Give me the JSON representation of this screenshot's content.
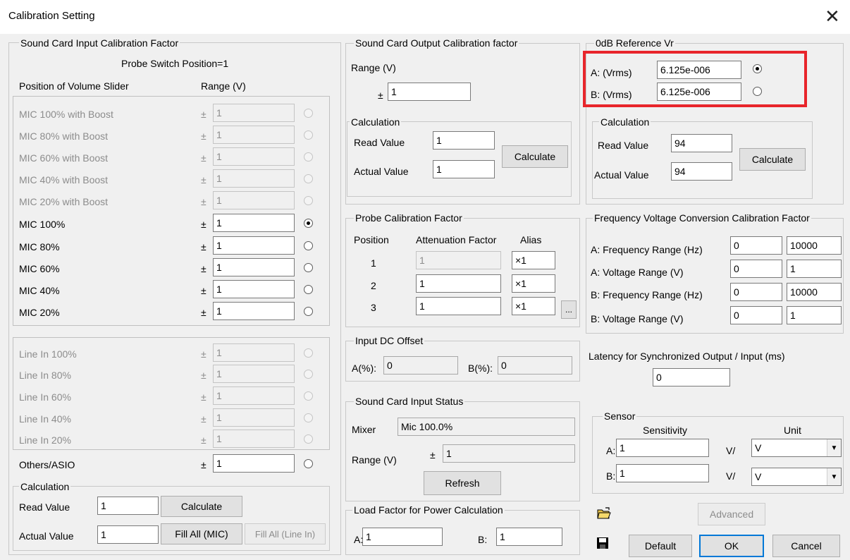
{
  "window": {
    "title": "Calibration Setting",
    "close": "✕"
  },
  "input_cal": {
    "title": "Sound Card Input Calibration Factor",
    "probe_switch": "Probe Switch Position=1",
    "col_position": "Position of Volume Slider",
    "col_range": "Range (V)",
    "pm": "±",
    "mic_boost_rows": [
      {
        "label": "MIC 100% with Boost",
        "value": "1"
      },
      {
        "label": "MIC 80% with Boost",
        "value": "1"
      },
      {
        "label": "MIC 60% with Boost",
        "value": "1"
      },
      {
        "label": "MIC 40% with Boost",
        "value": "1"
      },
      {
        "label": "MIC 20% with Boost",
        "value": "1"
      }
    ],
    "mic_rows": [
      {
        "label": "MIC 100%",
        "value": "1"
      },
      {
        "label": "MIC 80%",
        "value": "1"
      },
      {
        "label": "MIC 60%",
        "value": "1"
      },
      {
        "label": "MIC 40%",
        "value": "1"
      },
      {
        "label": "MIC 20%",
        "value": "1"
      }
    ],
    "line_rows": [
      {
        "label": "Line In 100%",
        "value": "1"
      },
      {
        "label": "Line In 80%",
        "value": "1"
      },
      {
        "label": "Line In 60%",
        "value": "1"
      },
      {
        "label": "Line In 40%",
        "value": "1"
      },
      {
        "label": "Line In 20%",
        "value": "1"
      }
    ],
    "others": {
      "label": "Others/ASIO",
      "value": "1"
    },
    "selected_row": "MIC 100%",
    "calc": {
      "title": "Calculation",
      "read_label": "Read Value",
      "read_value": "1",
      "actual_label": "Actual Value",
      "actual_value": "1",
      "calculate": "Calculate",
      "fill_mic": "Fill All (MIC)",
      "fill_line": "Fill All (Line In)"
    }
  },
  "output_cal": {
    "title": "Sound Card Output Calibration factor",
    "range_label": "Range (V)",
    "pm": "±",
    "range_value": "1",
    "calc": {
      "title": "Calculation",
      "read_label": "Read Value",
      "read_value": "1",
      "actual_label": "Actual Value",
      "actual_value": "1",
      "calculate": "Calculate"
    }
  },
  "probe": {
    "title": "Probe Calibration Factor",
    "col_position": "Position",
    "col_att": "Attenuation Factor",
    "col_alias": "Alias",
    "rows": [
      {
        "pos": "1",
        "att": "1",
        "alias": "×1"
      },
      {
        "pos": "2",
        "att": "1",
        "alias": "×1"
      },
      {
        "pos": "3",
        "att": "1",
        "alias": "×1"
      }
    ],
    "more": "..."
  },
  "dc_offset": {
    "title": "Input DC Offset",
    "a_label": "A(%):",
    "a_value": "0",
    "b_label": "B(%):",
    "b_value": "0"
  },
  "input_status": {
    "title": "Sound Card Input Status",
    "mixer_label": "Mixer",
    "mixer_value": "Mic 100.0%",
    "range_label": "Range (V)",
    "pm": "±",
    "range_value": "1",
    "refresh": "Refresh"
  },
  "load_factor": {
    "title": "Load Factor for Power Calculation",
    "a_label": "A:",
    "a_value": "1",
    "b_label": "B:",
    "b_value": "1"
  },
  "ref0db": {
    "title": "0dB Reference Vr",
    "a_label": "A: (Vrms)",
    "a_value": "6.125e-006",
    "b_label": "B: (Vrms)",
    "b_value": "6.125e-006",
    "selected": "A",
    "calc": {
      "title": "Calculation",
      "read_label": "Read Value",
      "read_value": "94",
      "actual_label": "Actual Value",
      "actual_value": "94",
      "calculate": "Calculate"
    }
  },
  "fv_conv": {
    "title": "Frequency Voltage Conversion Calibration Factor",
    "rows": [
      {
        "label": "A: Frequency Range (Hz)",
        "min": "0",
        "max": "10000"
      },
      {
        "label": "A: Voltage Range (V)",
        "min": "0",
        "max": "1"
      },
      {
        "label": "B: Frequency Range (Hz)",
        "min": "0",
        "max": "10000"
      },
      {
        "label": "B: Voltage Range (V)",
        "min": "0",
        "max": "1"
      }
    ]
  },
  "latency": {
    "label": "Latency for Synchronized Output / Input (ms)",
    "value": "0"
  },
  "sensor": {
    "title": "Sensor",
    "col_sensitivity": "Sensitivity",
    "col_unit": "Unit",
    "rows": [
      {
        "label": "A:",
        "value": "1",
        "per": "V/",
        "unit": "V"
      },
      {
        "label": "B:",
        "value": "1",
        "per": "V/",
        "unit": "V"
      }
    ]
  },
  "footer": {
    "advanced": "Advanced",
    "default": "Default",
    "ok": "OK",
    "cancel": "Cancel"
  },
  "colors": {
    "highlight": "#e8252b",
    "default_button_border": "#0078d7"
  }
}
